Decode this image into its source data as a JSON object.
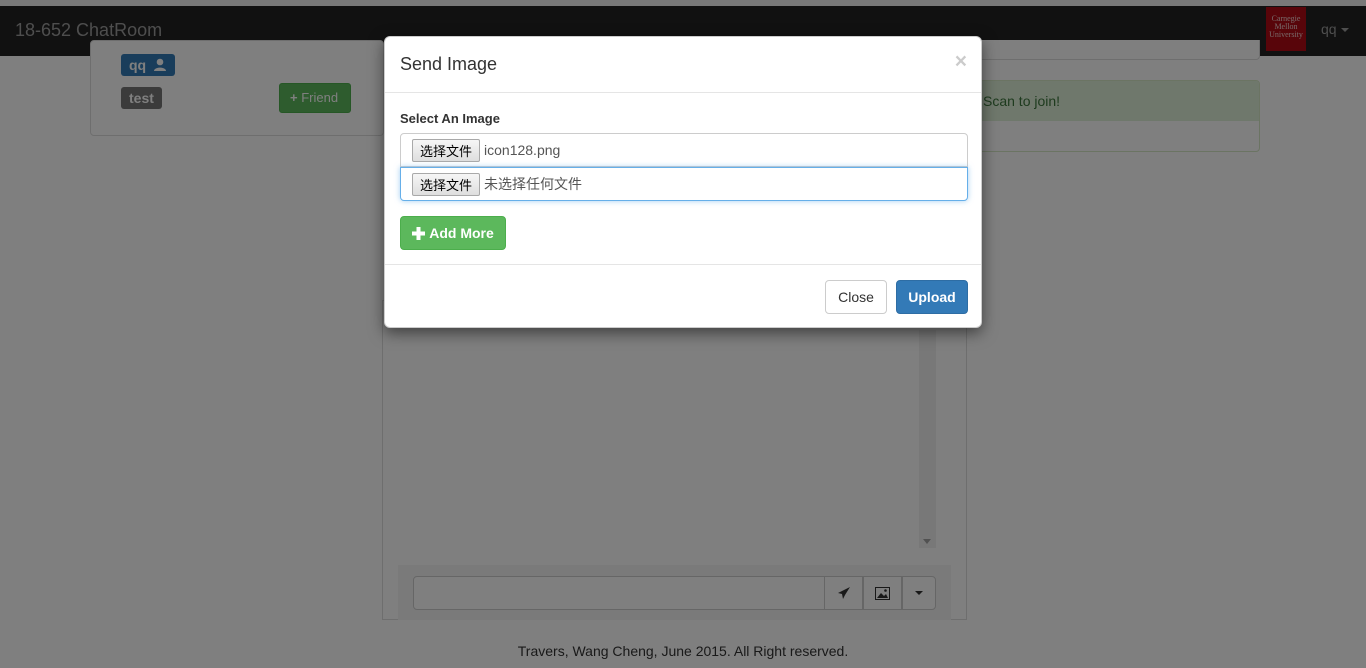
{
  "navbar": {
    "brand": "18-652 ChatRoom",
    "logo_text": "Carnegie Mellon University",
    "user": "qq"
  },
  "friends": {
    "me_label": "qq",
    "user_label": "test",
    "add_friend_label": "Friend"
  },
  "side": {
    "alert_text": "Scan to join!"
  },
  "chat": {
    "input_value": "",
    "send_icon": "paper-plane-icon",
    "image_icon": "picture-icon"
  },
  "footer": {
    "copyright": "Travers, Wang Cheng, June 2015. All Right reserved."
  },
  "modal": {
    "title": "Send Image",
    "close_symbol": "×",
    "field_label": "Select An Image",
    "files": [
      {
        "button": "选择文件",
        "status": "icon128.png"
      },
      {
        "button": "选择文件",
        "status": "未选择任何文件"
      }
    ],
    "add_more_label": "Add More",
    "close_label": "Close",
    "upload_label": "Upload"
  },
  "colors": {
    "navbar": "#222222",
    "primary": "#337ab7",
    "success": "#5cb85c"
  }
}
